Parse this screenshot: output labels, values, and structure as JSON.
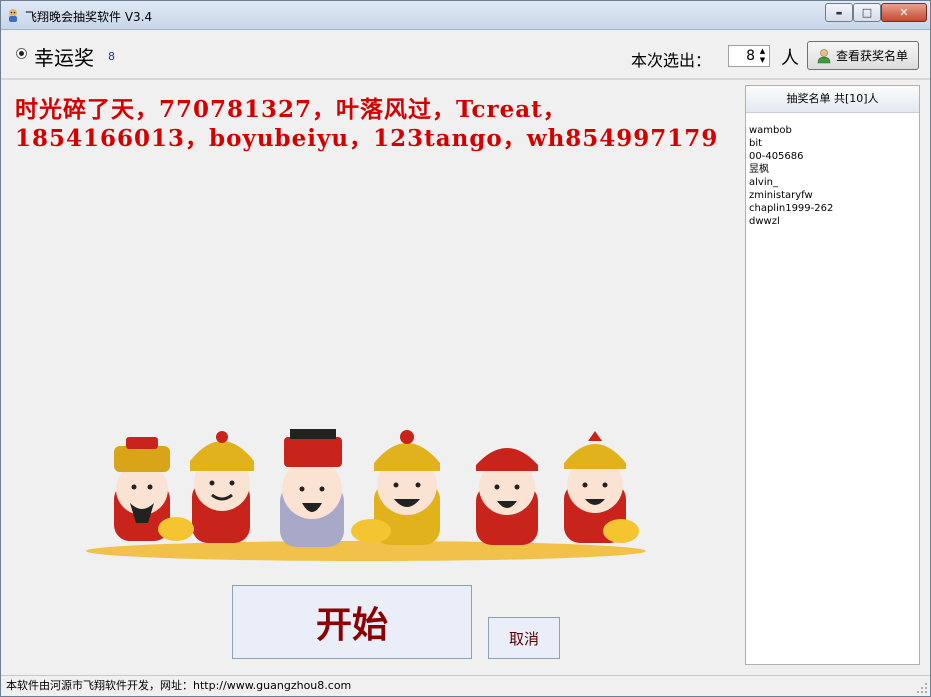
{
  "window": {
    "title": "飞翔晚会抽奖软件 V3.4",
    "controls": {
      "minimize": "▬",
      "maximize": "□",
      "close": "✕"
    }
  },
  "toolbar": {
    "prize_name": "幸运奖",
    "prize_count": "8",
    "select_label": "本次选出：",
    "select_value": "8",
    "people_unit": "人",
    "view_winners_label": "查看获奖名单"
  },
  "draw_result": {
    "names_line1": "时光碎了天，770781327，叶落风过，Tcreat，",
    "names_line2": "1854166013，boyubeiyu，123tango，wh854997179"
  },
  "draw_list": {
    "header": "抽奖名单 共[10]人",
    "items": [
      "wambob",
      "bit",
      "00-405686",
      "昱枫",
      "alvin_",
      "zministaryfw",
      "chaplin1999-262",
      "dwwzl"
    ]
  },
  "buttons": {
    "start": "开始",
    "cancel": "取消"
  },
  "status": {
    "text": "本软件由河源市飞翔软件开发，网址：http://www.guangzhou8.com"
  },
  "colors": {
    "names_text": "#d40000",
    "start_text": "#8b0000",
    "accent_blue": "#1a3a9a"
  },
  "icons": {
    "app": "app-icon",
    "person": "person-icon",
    "illustration": "fortune-gods-illustration"
  }
}
